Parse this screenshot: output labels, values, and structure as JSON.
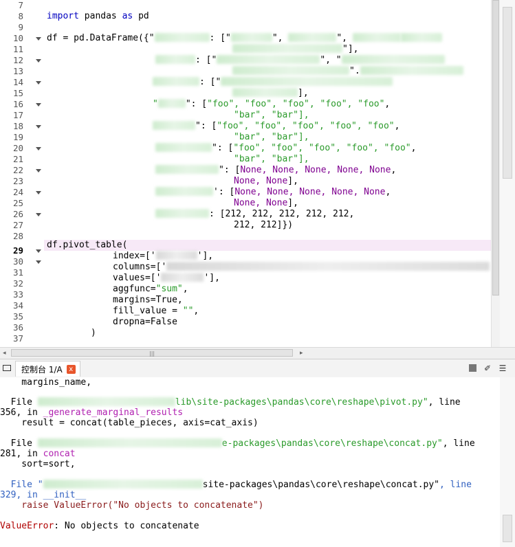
{
  "editor": {
    "line_numbers": [
      "7",
      "8",
      "9",
      "10",
      "11",
      "12",
      "13",
      "14",
      "15",
      "16",
      "17",
      "18",
      "19",
      "20",
      "21",
      "22",
      "23",
      "24",
      "25",
      "26",
      "27",
      "28",
      "29",
      "30",
      "31",
      "32",
      "33",
      "34",
      "35",
      "36",
      "37"
    ],
    "fold_lines": [
      "10",
      "12",
      "14",
      "16",
      "18",
      "20",
      "22",
      "24",
      "26",
      "29",
      "30"
    ],
    "current_line": "29",
    "code": {
      "l8_kw1": "import",
      "l8_mid": " pandas ",
      "l8_kw2": "as",
      "l8_end": " pd",
      "l10_a": "df = pd.DataFrame({\"",
      "l10_b": ": [\"",
      "l10_c": "\", ",
      "l10_d": "\", ",
      "l11": "\"],",
      "l12_a": ": [\"",
      "l12_b": "\", \"",
      "l13": "\".",
      "l14_a": ": [\"",
      "l15": "],",
      "l16_a": "\"",
      "l16_b": "\": [",
      "l16_c": "\"foo\", \"foo\", \"foo\", \"foo\", \"foo\"",
      "l16_d": ",",
      "l17": "\"bar\", \"bar\"],",
      "l18_a": "\": [",
      "l18_b": "\"foo\", \"foo\", \"foo\", \"foo\", \"foo\"",
      "l18_c": ",",
      "l19": "\"bar\", \"bar\"],",
      "l20_a": "\": [",
      "l20_b": "\"foo\", \"foo\", \"foo\", \"foo\", \"foo\"",
      "l20_c": ",",
      "l21": "\"bar\", \"bar\"],",
      "l22_a": "\": [",
      "l22_b": "None, None, None, None, None",
      "l22_c": ",",
      "l23_a": "None, None",
      "l23_b": "],",
      "l24_a": "': [",
      "l24_b": "None, None, None, None, None",
      "l24_c": ",",
      "l25_a": "None, None",
      "l25_b": "],",
      "l26": ": [212, 212, 212, 212, 212,",
      "l27": "212, 212]})",
      "l29": "df.pivot_table(",
      "l30_a": "index=['",
      "l30_b": "'],",
      "l31_a": "columns=['",
      "l32_a": "values=['",
      "l32_b": "'],",
      "l33_a": "aggfunc=",
      "l33_b": "\"sum\"",
      "l33_c": ",",
      "l34": "margins=True,",
      "l35_a": "fill_value = ",
      "l35_b": "\"\"",
      "l35_c": ",",
      "l36": "dropna=False",
      "l37": ")"
    }
  },
  "console_bar": {
    "tab_label": "控制台 1/A",
    "close_icon": "x"
  },
  "console": {
    "c1": "    margins_name,",
    "c2_a": "  File ",
    "c2_b": "lib\\site-packages\\pandas\\core\\reshape\\pivot.py\"",
    "c2_c": ", line",
    "c3_a": "356, in ",
    "c3_b": "_generate_marginal_results",
    "c4": "    result = concat(table_pieces, axis=cat_axis)",
    "c5_a": "  File ",
    "c5_b": "e-packages\\pandas\\core\\reshape\\concat.py\"",
    "c5_c": ", line",
    "c6_a": "281, in ",
    "c6_b": "concat",
    "c7": "    sort=sort,",
    "c8_a": "  File \"",
    "c8_b": "site-packages\\pandas\\core\\reshape\\concat.py\"",
    "c8_c": ", line",
    "c9_a": "329, in ",
    "c9_b": "__init__",
    "c10": "    raise ValueError(\"No objects to concatenate\")",
    "c11_a": "ValueError",
    "c11_b": ": No objects to concatenate"
  },
  "colors": {
    "keyword": "#0000c0",
    "string": "#2a9a2a",
    "none": "#7f0090",
    "current_line": "#f7e9f7",
    "close_button": "#e8552b"
  }
}
